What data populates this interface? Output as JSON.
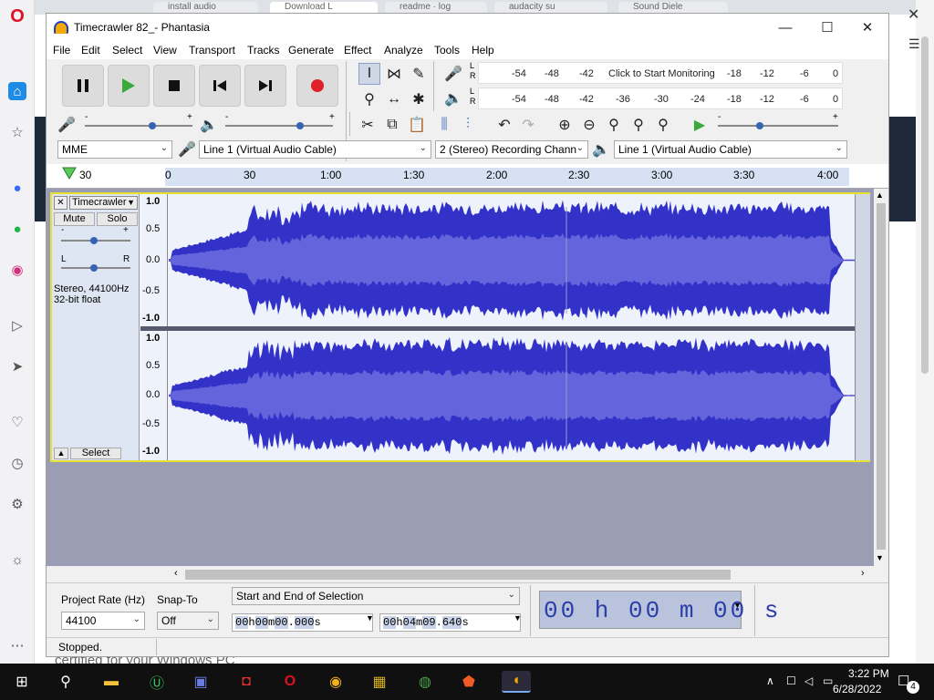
{
  "browser": {
    "tabs": [
      "install audio",
      "Download L",
      "readme · log",
      "audacity su",
      "Sound Diele"
    ],
    "background_text": "certified for your Windows PC"
  },
  "opera_sidebar": {
    "logo": "opera-logo-icon",
    "items": [
      "home-icon",
      "star-icon",
      "messenger-icon",
      "whatsapp-icon",
      "instagram-icon",
      "player-icon",
      "send-icon",
      "heart-icon",
      "clock-icon",
      "settings-icon",
      "lightbulb-icon",
      "more-icon"
    ]
  },
  "window": {
    "title": "Timecrawler 82_- Phantasia",
    "minimize": "—",
    "maximize": "☐",
    "close": "✕"
  },
  "menu": [
    "File",
    "Edit",
    "Select",
    "View",
    "Transport",
    "Tracks",
    "Generate",
    "Effect",
    "Analyze",
    "Tools",
    "Help"
  ],
  "transport": [
    "pause-icon",
    "play-icon",
    "stop-icon",
    "skip-to-start-icon",
    "skip-to-end-icon",
    "record-icon"
  ],
  "meters": {
    "record": {
      "L": "L",
      "R": "R",
      "ticks": [
        "-54",
        "-48",
        "-42",
        "-18",
        "-12",
        "-6",
        "0"
      ],
      "prompt": "Click to Start Monitoring"
    },
    "playback": {
      "L": "L",
      "R": "R",
      "ticks": [
        "-54",
        "-48",
        "-42",
        "-36",
        "-30",
        "-24",
        "-18",
        "-12",
        "-6",
        "0"
      ]
    }
  },
  "mixer": {
    "minus": "-",
    "plus": "+"
  },
  "devices": {
    "host": "MME",
    "recording_device": "Line 1 (Virtual Audio Cable)",
    "channels": "2 (Stereo) Recording Chann",
    "playback_device": "Line 1 (Virtual Audio Cable)"
  },
  "ruler": {
    "labels": [
      "30",
      "0",
      "30",
      "1:00",
      "1:30",
      "2:00",
      "2:30",
      "3:00",
      "3:30",
      "4:00"
    ]
  },
  "track": {
    "name": "Timecrawler",
    "close": "✕",
    "mute": "Mute",
    "solo": "Solo",
    "gain_minus": "-",
    "gain_plus": "+",
    "pan_left": "L",
    "pan_right": "R",
    "info_line1": "Stereo, 44100Hz",
    "info_line2": "32-bit float",
    "select": "Select",
    "collapse": "▲",
    "scale": [
      "1.0",
      "0.5",
      "0.0",
      "-0.5",
      "-1.0"
    ],
    "waveform_color": "#3232c8",
    "rms_color": "#6464dc"
  },
  "selection": {
    "project_rate_label": "Project Rate (Hz)",
    "project_rate": "44100",
    "snap_to_label": "Snap-To",
    "snap_to": "Off",
    "selection_mode": "Start and End of Selection",
    "start": [
      "0",
      "0",
      "h",
      "0",
      "0",
      "m",
      "0",
      "0",
      ".",
      "0",
      "0",
      "0",
      "s"
    ],
    "end": [
      "0",
      "0",
      "h",
      "0",
      "4",
      "m",
      "0",
      "9",
      ".",
      "6",
      "4",
      "0",
      "s"
    ],
    "big_time": "00 h 00 m 00 s"
  },
  "status": "Stopped.",
  "taskbar": {
    "time": "3:22 PM",
    "date": "6/28/2022",
    "notifications": "4",
    "apps": [
      "windows-start-icon",
      "search-icon",
      "file-explorer-icon",
      "upwork-icon",
      "teams-icon",
      "video-recorder-icon",
      "opera-icon",
      "browser-icon",
      "winrar-icon",
      "globe-icon",
      "brave-icon",
      "audacity-icon"
    ]
  }
}
